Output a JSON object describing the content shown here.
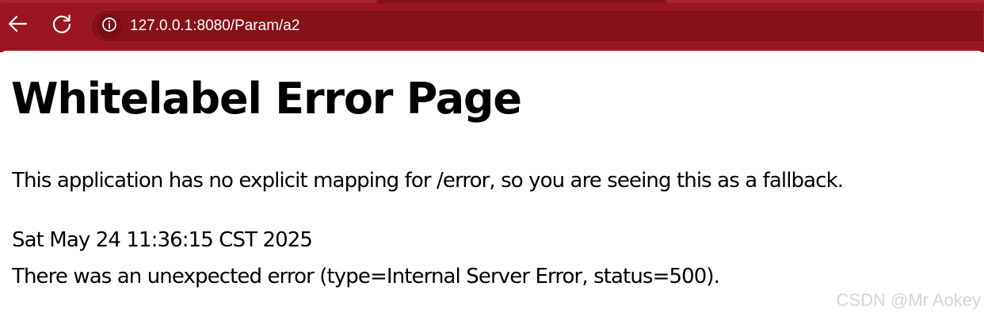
{
  "browser": {
    "url": "127.0.0.1:8080/Param/a2",
    "icons": {
      "back": "back-arrow-icon",
      "reload": "reload-icon",
      "site_info": "info-icon"
    },
    "colors": {
      "chrome": "#9b1520",
      "omnibox": "#871019",
      "icon": "#ffffff"
    }
  },
  "page": {
    "title": "Whitelabel Error Page",
    "message": "This application has no explicit mapping for /error, so you are seeing this as a fallback.",
    "timestamp": "Sat May 24 11:36:15 CST 2025",
    "error_detail": "There was an unexpected error (type=Internal Server Error, status=500)."
  },
  "watermark": "CSDN @Mr  Aokey"
}
